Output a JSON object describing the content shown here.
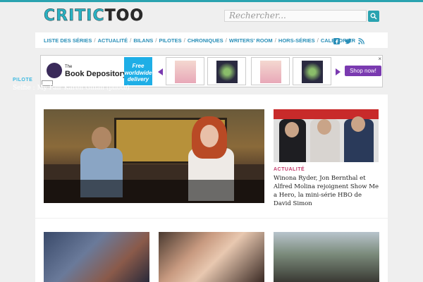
{
  "header": {
    "logo_part1": "CRITIC",
    "logo_part2": "TOO",
    "search_placeholder": "Rechercher...",
    "search_icon": "search-icon"
  },
  "nav": {
    "items": [
      "LISTE DES SÉRIES",
      "ACTUALITÉ",
      "BILANS",
      "PILOTES",
      "CHRONIQUES",
      "WRITERS' ROOM",
      "HORS-SÉRIES",
      "CALENDRIER"
    ],
    "social_icons": [
      "facebook-icon",
      "twitter-icon",
      "rss-icon"
    ]
  },
  "ad": {
    "brand_small": "The",
    "brand_name": "Book Depository",
    "badge": "Free worldwide delivery",
    "button": "Shop now!",
    "close": "×"
  },
  "featured": {
    "category": "PILOTE",
    "title": "Selfie : My Fair Karen Gillan (pilote)"
  },
  "side_article": {
    "category": "ACTUALITÉ",
    "title": "Winona Ryder, Jon Bernthal et Alfred Molina rejoignent Show Me a Hero, la mini-série HBO de David Simon"
  },
  "colors": {
    "accent": "#2aa3b0",
    "nav_link": "#2a8fb8",
    "category_blue": "#3ab8e0",
    "category_pink": "#c23a6a",
    "ad_badge": "#1eaee6",
    "ad_button": "#7a3ab0"
  }
}
